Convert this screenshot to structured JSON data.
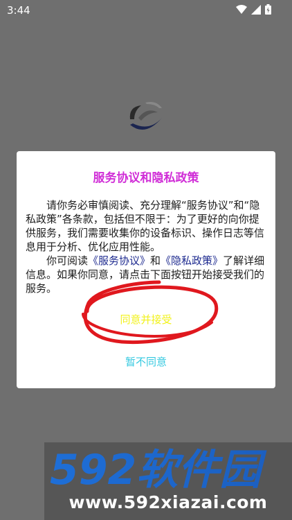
{
  "status_bar": {
    "time": "3:44",
    "icons": [
      "wifi-icon",
      "signal-icon",
      "battery-icon"
    ]
  },
  "splash": {
    "logo_icon": "swoosh-logo-icon"
  },
  "dialog": {
    "title": "服务协议和隐私政策",
    "paragraph1": "请你务必审慎阅读、充分理解“服务协议”和“隐私政策”各条款，包括但不限于：为了更好的向你提供服务，我们需要收集你的设备标识、操作日志等信息用于分析、优化应用性能。",
    "paragraph2_prefix": "你可阅读",
    "link_service": "《服务协议》",
    "paragraph2_and": "和",
    "link_privacy": "《隐私政策》",
    "paragraph2_suffix": "了解详细信息。如果你同意，请点击下面按钮开始接受我们的服务。",
    "accept_label": "同意并接受",
    "reject_label": "暂不同意"
  },
  "colors": {
    "title": "#d02ed7",
    "link": "#1d2a8f",
    "accept": "#f2f21c",
    "reject": "#35c9e0",
    "annotation": "#e0181e"
  },
  "watermark": {
    "logo_text": "592软件园",
    "url": "www.592xiazai.com"
  }
}
